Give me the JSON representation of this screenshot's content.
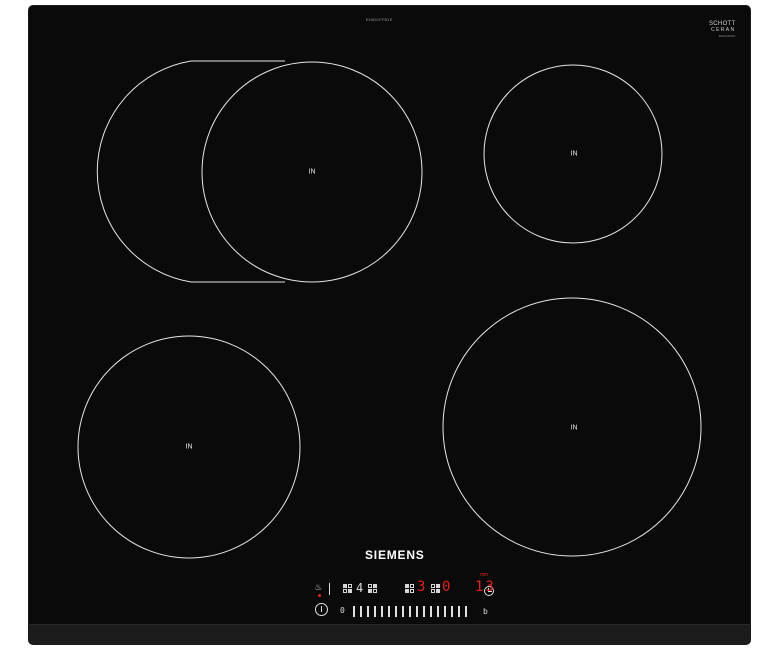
{
  "model_number": "EH651FFB1E",
  "logo": {
    "line1": "SCHOTT",
    "line2": "CERAN",
    "code": "8001234567"
  },
  "zones": [
    {
      "label": "IN"
    },
    {
      "label": "IN"
    },
    {
      "label": "IN"
    },
    {
      "label": "IN"
    }
  ],
  "brand": "SIEMENS",
  "controls": {
    "zone_power_level": "4",
    "timer_digit_1": "3",
    "timer_digit_2": "0",
    "timer_label": "min",
    "timer_value": "13",
    "bar_start": "0",
    "bar_end": "b",
    "slider_steps": 17
  },
  "colors": {
    "glass": "#0a0a0a",
    "ring": "#e6e6e6",
    "indicator": "#e0241c"
  }
}
